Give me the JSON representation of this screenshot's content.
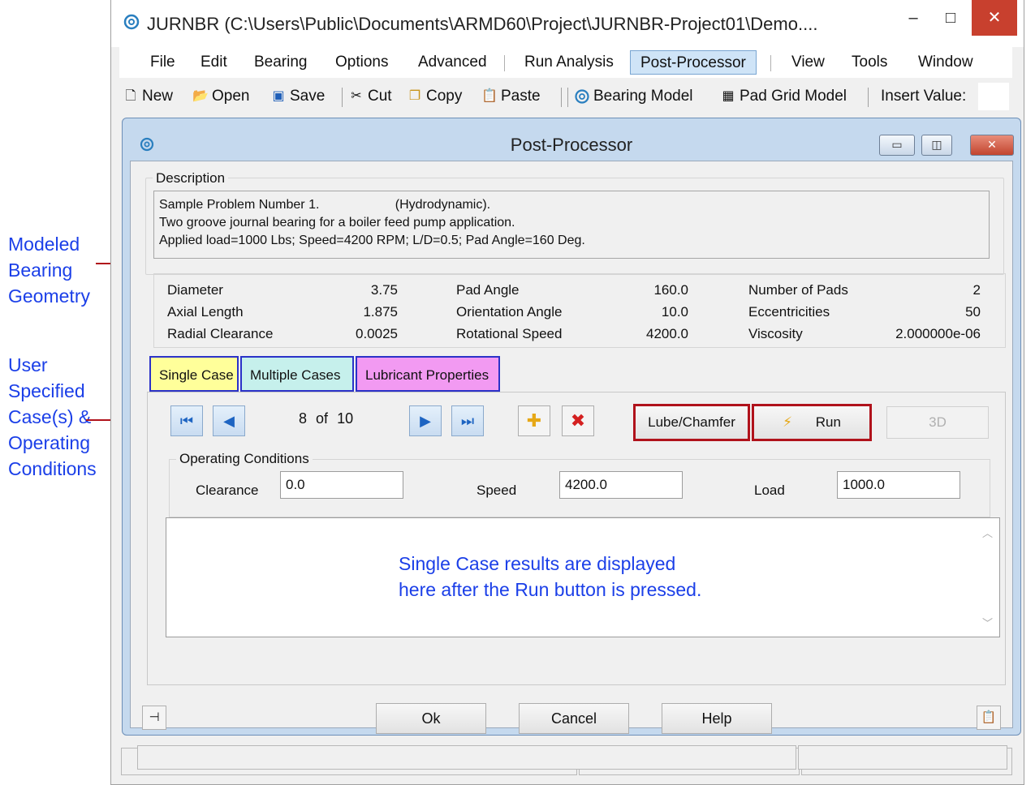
{
  "annotations": {
    "geometry_label": [
      "Modeled",
      "Bearing",
      "Geometry"
    ],
    "cases_label": [
      "User",
      "Specified",
      "Case(s) &",
      "Operating",
      "Conditions"
    ]
  },
  "app": {
    "title": "JURNBR (C:\\Users\\Public\\Documents\\ARMD60\\Project\\JURNBR-Project01\\Demo....",
    "min": "–",
    "max": "□",
    "close": "✕"
  },
  "menu": [
    "File",
    "Edit",
    "Bearing",
    "Options",
    "Advanced",
    "Run Analysis",
    "Post-Processor",
    "View",
    "Tools",
    "Window"
  ],
  "toolbar": {
    "new": "New",
    "open": "Open",
    "save": "Save",
    "cut": "Cut",
    "copy": "Copy",
    "paste": "Paste",
    "bearing_model": "Bearing Model",
    "pad_grid_model": "Pad Grid Model",
    "insert_value": "Insert Value:"
  },
  "dialog": {
    "title": "Post-Processor",
    "description_legend": "Description",
    "description_lines": [
      "Sample Problem Number 1.                     (Hydrodynamic).",
      "Two groove journal bearing for a boiler feed pump application.",
      "Applied load=1000 Lbs; Speed=4200 RPM; L/D=0.5; Pad Angle=160 Deg."
    ],
    "params": {
      "diameter_label": "Diameter",
      "diameter": "3.75",
      "axial_length_label": "Axial Length",
      "axial_length": "1.875",
      "radial_clearance_label": "Radial Clearance",
      "radial_clearance": "0.0025",
      "pad_angle_label": "Pad Angle",
      "pad_angle": "160.0",
      "orientation_angle_label": "Orientation Angle",
      "orientation_angle": "10.0",
      "rotational_speed_label": "Rotational Speed",
      "rotational_speed": "4200.0",
      "num_pads_label": "Number of Pads",
      "num_pads": "2",
      "eccentricities_label": "Eccentricities",
      "eccentricities": "50",
      "viscosity_label": "Viscosity",
      "viscosity": "2.000000e-06"
    },
    "tabs": [
      "Single Case",
      "Multiple Cases",
      "Lubricant Properties"
    ],
    "case_counter": {
      "current": "8",
      "of": "of",
      "total": "10"
    },
    "lube_chamfer": "Lube/Chamfer",
    "run": "Run",
    "three_d": "3D",
    "op_legend": "Operating Conditions",
    "clearance_label": "Clearance",
    "clearance_value": "0.0",
    "speed_label": "Speed",
    "speed_value": "4200.0",
    "load_label": "Load",
    "load_value": "1000.0",
    "results_msg": [
      "Single Case results are displayed",
      "here after the Run button is pressed."
    ],
    "ok": "Ok",
    "cancel": "Cancel",
    "help": "Help"
  },
  "status": {
    "project": "JURNBR-Project01"
  },
  "colors": {
    "annotation_blue": "#1b3fe8",
    "run_highlight": "#b0121b",
    "tab_single": "#ffff9a",
    "tab_multiple": "#c6f0ec",
    "tab_lubricant": "#f29af2",
    "close_red": "#c8402e"
  }
}
